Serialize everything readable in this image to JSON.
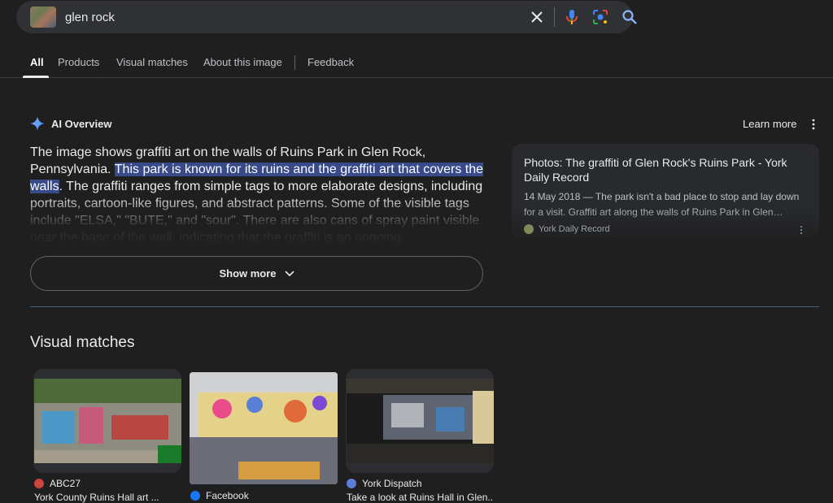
{
  "search": {
    "query": "glen rock",
    "icons": [
      "image-thumbnail",
      "close-icon",
      "mic-icon",
      "lens-icon",
      "search-icon"
    ]
  },
  "tabs": [
    {
      "label": "All",
      "active": true
    },
    {
      "label": "Products"
    },
    {
      "label": "Visual matches"
    },
    {
      "label": "About this image"
    },
    {
      "label": "Feedback"
    }
  ],
  "ai_overview": {
    "title": "AI Overview",
    "learn_more": "Learn more",
    "text_pre": "The image shows graffiti art on the walls of Ruins Park in Glen Rock, Pennsylvania. ",
    "text_highlight": "This park is known for its ruins and the graffiti art that covers the walls",
    "text_post": ". The graffiti ranges from simple tags to more elaborate designs, including portraits, cartoon-like figures, and abstract patterns. Some of the visible tags include \"ELSA,\" \"BUTE,\" and \"sour\". There are also cans of spray paint visible near the base of the wall, indicating that the graffiti is an ongoing",
    "show_more": "Show more"
  },
  "source_card": {
    "title": "Photos: The graffiti of Glen Rock's Ruins Park - York Daily Record",
    "snippet": "14 May 2018 — The park isn't a bad place to stop and lay down for a visit. Graffiti art along the walls of Ruins Park in Glen…",
    "source": "York Daily Record"
  },
  "visual_matches": {
    "title": "Visual matches",
    "items": [
      {
        "source": "ABC27",
        "caption": "York County Ruins Hall art ..."
      },
      {
        "source": "Facebook",
        "caption": ""
      },
      {
        "source": "York Dispatch",
        "caption": "Take a look at Ruins Hall in Glen..."
      }
    ]
  },
  "colors": {
    "background": "#1f1f1f",
    "search_bar": "#303134",
    "highlight": "#394a8a",
    "card": "#282a2e"
  }
}
